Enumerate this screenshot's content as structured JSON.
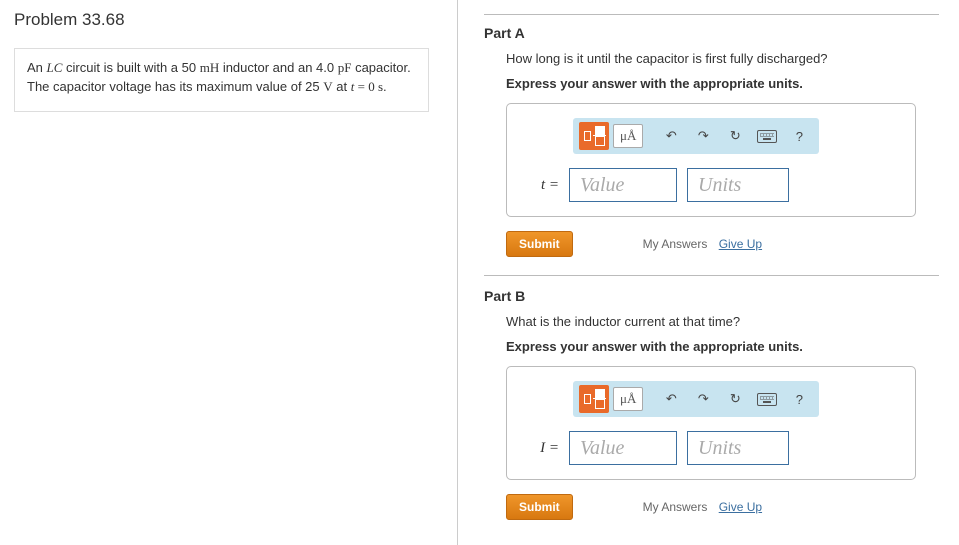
{
  "problem": {
    "title": "Problem 33.68",
    "text_html": "An <span class='ser'><i>LC</i></span> circuit is built with a 50 <span class='ser'>mH</span> inductor and an 4.0 <span class='ser'>pF</span> capacitor. The capacitor voltage has its maximum value of 25 <span class='ser'>V</span> at <span class='ser'><i>t</i> = 0 s</span>."
  },
  "toolbar": {
    "units_label": "μÅ",
    "undo_glyph": "↶",
    "redo_glyph": "↷",
    "reset_glyph": "↻",
    "help_glyph": "?"
  },
  "common": {
    "submit_label": "Submit",
    "my_answers_label": "My Answers",
    "give_up_label": "Give Up",
    "value_placeholder": "Value",
    "units_placeholder": "Units"
  },
  "parts": {
    "A": {
      "label": "Part A",
      "question": "How long is it until the capacitor is first fully discharged?",
      "instruction": "Express your answer with the appropriate units.",
      "var_label": "t ="
    },
    "B": {
      "label": "Part B",
      "question": "What is the inductor current at that time?",
      "instruction": "Express your answer with the appropriate units.",
      "var_label": "I ="
    }
  }
}
